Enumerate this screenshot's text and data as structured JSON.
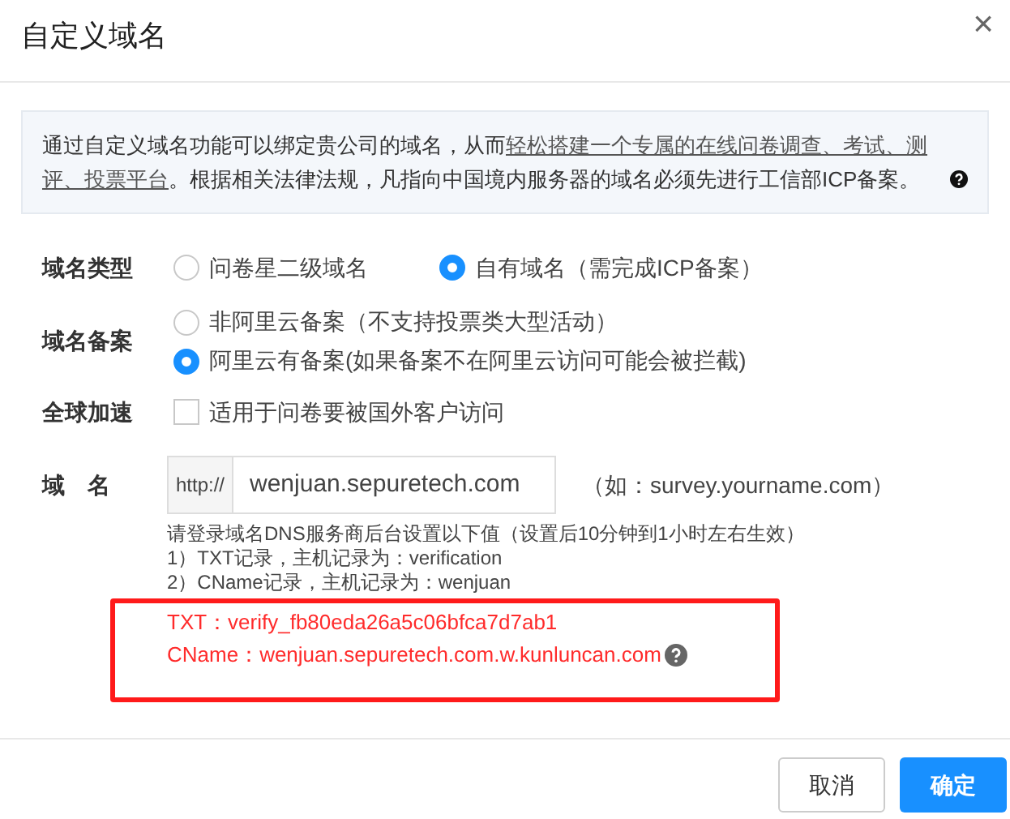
{
  "dialog": {
    "title": "自定义域名",
    "close": "×"
  },
  "notice": {
    "text": "通过自定义域名功能可以绑定贵公司的域名，从而",
    "link": [
      "轻松搭建一个专属的在线问卷调查、考试、测",
      "评、投票平台"
    ],
    "rest": "。根据相关法律法规，凡指向中国境内服务器的域名必须先进行工信部ICP备案。"
  },
  "domain_type": {
    "label": "域名类型",
    "options": [
      {
        "label": "问卷星二级域名",
        "selected": false
      },
      {
        "label": "自有域名（需完成ICP备案）",
        "selected": true
      }
    ]
  },
  "filing": {
    "label": "域名备案",
    "options": [
      {
        "label": "非阿里云备案（不支持投票类大型活动）",
        "selected": false
      },
      {
        "label": "阿里云有备案(如果备案不在阿里云访问可能会被拦截)",
        "selected": true
      }
    ]
  },
  "acceleration": {
    "label": "全球加速",
    "option": "适用于问卷要被国外客户访问",
    "checked": false
  },
  "domain": {
    "label": "域　名",
    "prefix": "http://",
    "value": "wenjuan.sepuretech.com",
    "example": "（如：survey.yourname.com）"
  },
  "instructions": [
    "请登录域名DNS服务商后台设置以下值（设置后10分钟到1小时左右生效）",
    "1）TXT记录，主机记录为：verification",
    "2）CName记录，主机记录为：wenjuan"
  ],
  "records": [
    "TXT：verify_fb80eda26a5c06bfca7d7ab1",
    "CName：wenjuan.sepuretech.com.w.kunluncan.com"
  ],
  "buttons": [
    {
      "label": "取消",
      "kind": "secondary"
    },
    {
      "label": "确定",
      "kind": "primary"
    }
  ]
}
